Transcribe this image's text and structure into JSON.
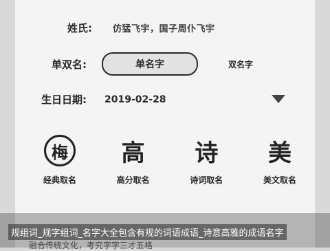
{
  "form": {
    "surname_label": "姓氏:",
    "surname_value": "仿猛飞宇，国子周仆飞宇",
    "name_type_label": "单双名:",
    "name_type_selected": "单名字",
    "name_type_other": "双名字",
    "birth_label": "生日日期:",
    "birth_value": "2019-02-28"
  },
  "features": [
    {
      "glyph": "梅",
      "label": "经典取名"
    },
    {
      "glyph": "高",
      "label": "高分取名"
    },
    {
      "glyph": "诗",
      "label": "诗词取名"
    },
    {
      "glyph": "美",
      "label": "美文取名"
    }
  ],
  "ad": {
    "line1": "规组词_规字组词_名字大全包含有规的词语成语_诗意高雅的成语名字",
    "line2": "融合传统文化，考究字字三才五格"
  }
}
